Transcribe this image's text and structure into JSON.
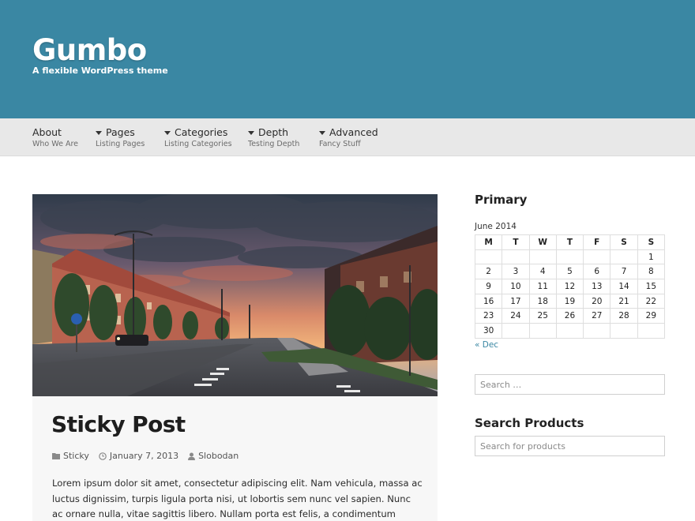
{
  "header": {
    "title": "Gumbo",
    "description": "A flexible WordPress theme"
  },
  "nav": [
    {
      "label": "About",
      "sub": "Who We Are",
      "dropdown": false
    },
    {
      "label": "Pages",
      "sub": "Listing Pages",
      "dropdown": true
    },
    {
      "label": "Categories",
      "sub": "Listing Categories",
      "dropdown": true
    },
    {
      "label": "Depth",
      "sub": "Testing Depth",
      "dropdown": true
    },
    {
      "label": "Advanced",
      "sub": "Fancy Stuff",
      "dropdown": true
    }
  ],
  "post": {
    "title": "Sticky Post",
    "category": "Sticky",
    "date": "January 7, 2013",
    "author": "Slobodan",
    "excerpt": "Lorem ipsum dolor sit amet, consectetur adipiscing elit. Nam vehicula, massa ac luctus dignissim, turpis ligula porta nisi, ut lobortis sem nunc vel sapien. Nunc ac ornare nulla, vitae sagittis libero. Nullam porta est felis, a condimentum lorem sollicitudin eu. Ut"
  },
  "sidebar": {
    "primary_title": "Primary",
    "calendar": {
      "caption": "June 2014",
      "weekdays": [
        "M",
        "T",
        "W",
        "T",
        "F",
        "S",
        "S"
      ],
      "weeks": [
        [
          "",
          "",
          "",
          "",
          "",
          "",
          "1"
        ],
        [
          "2",
          "3",
          "4",
          "5",
          "6",
          "7",
          "8"
        ],
        [
          "9",
          "10",
          "11",
          "12",
          "13",
          "14",
          "15"
        ],
        [
          "16",
          "17",
          "18",
          "19",
          "20",
          "21",
          "22"
        ],
        [
          "23",
          "24",
          "25",
          "26",
          "27",
          "28",
          "29"
        ],
        [
          "30",
          "",
          "",
          "",
          "",
          "",
          ""
        ]
      ],
      "prev_link": "« Dec"
    },
    "search_placeholder": "Search …",
    "products_title": "Search Products",
    "products_placeholder": "Search for products"
  },
  "colors": {
    "header_bg": "#3a87a3",
    "nav_bg": "#e8e8e8",
    "link": "#3a87a3"
  }
}
